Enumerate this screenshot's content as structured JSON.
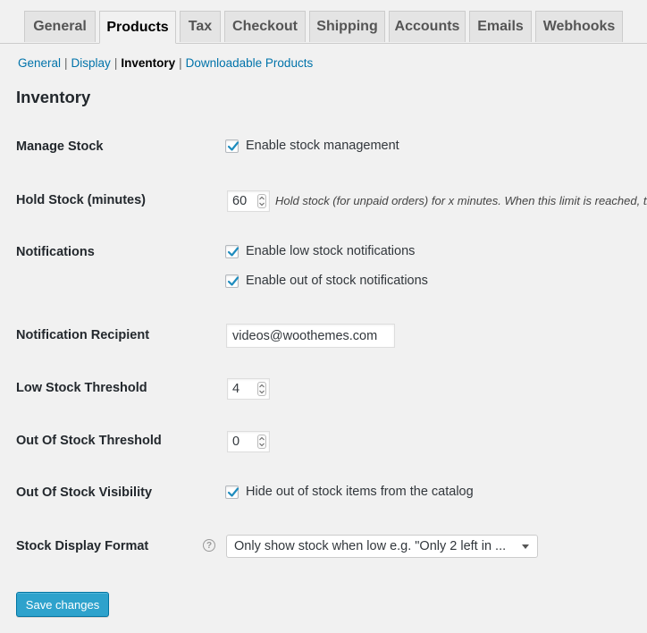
{
  "tabs": [
    {
      "label": "General"
    },
    {
      "label": "Products",
      "active": true
    },
    {
      "label": "Tax"
    },
    {
      "label": "Checkout"
    },
    {
      "label": "Shipping"
    },
    {
      "label": "Accounts"
    },
    {
      "label": "Emails"
    },
    {
      "label": "Webhooks"
    }
  ],
  "subnav": {
    "items": [
      "General",
      "Display",
      "Inventory",
      "Downloadable Products"
    ],
    "current": "Inventory",
    "separator": "|"
  },
  "section_title": "Inventory",
  "fields": {
    "manage_stock": {
      "label": "Manage Stock",
      "checkbox_label": "Enable stock management",
      "checked": true
    },
    "hold_stock": {
      "label": "Hold Stock (minutes)",
      "value": "60",
      "description": "Hold stock (for unpaid orders) for x minutes. When this limit is reached, th"
    },
    "notifications": {
      "label": "Notifications",
      "low_label": "Enable low stock notifications",
      "low_checked": true,
      "out_label": "Enable out of stock notifications",
      "out_checked": true
    },
    "notification_recipient": {
      "label": "Notification Recipient",
      "value": "videos@woothemes.com"
    },
    "low_stock_threshold": {
      "label": "Low Stock Threshold",
      "value": "4"
    },
    "out_of_stock_threshold": {
      "label": "Out Of Stock Threshold",
      "value": "0"
    },
    "out_of_stock_visibility": {
      "label": "Out Of Stock Visibility",
      "checkbox_label": "Hide out of stock items from the catalog",
      "checked": true
    },
    "stock_display_format": {
      "label": "Stock Display Format",
      "help_icon": "question-circle-icon",
      "selected": "Only show stock when low e.g. \"Only 2 left in ..."
    }
  },
  "save_button": "Save changes",
  "colors": {
    "link": "#0073aa",
    "button": "#2ea2cc",
    "check": "#1e8cbe"
  }
}
